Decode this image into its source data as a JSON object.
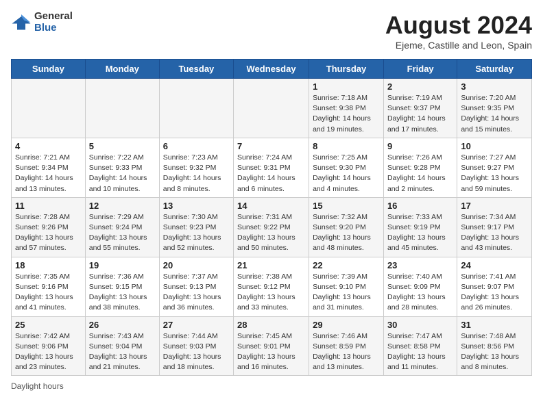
{
  "header": {
    "logo_general": "General",
    "logo_blue": "Blue",
    "month_year": "August 2024",
    "location": "Ejeme, Castille and Leon, Spain"
  },
  "days_of_week": [
    "Sunday",
    "Monday",
    "Tuesday",
    "Wednesday",
    "Thursday",
    "Friday",
    "Saturday"
  ],
  "weeks": [
    [
      {
        "day": "",
        "info": ""
      },
      {
        "day": "",
        "info": ""
      },
      {
        "day": "",
        "info": ""
      },
      {
        "day": "",
        "info": ""
      },
      {
        "day": "1",
        "info": "Sunrise: 7:18 AM\nSunset: 9:38 PM\nDaylight: 14 hours\nand 19 minutes."
      },
      {
        "day": "2",
        "info": "Sunrise: 7:19 AM\nSunset: 9:37 PM\nDaylight: 14 hours\nand 17 minutes."
      },
      {
        "day": "3",
        "info": "Sunrise: 7:20 AM\nSunset: 9:35 PM\nDaylight: 14 hours\nand 15 minutes."
      }
    ],
    [
      {
        "day": "4",
        "info": "Sunrise: 7:21 AM\nSunset: 9:34 PM\nDaylight: 14 hours\nand 13 minutes."
      },
      {
        "day": "5",
        "info": "Sunrise: 7:22 AM\nSunset: 9:33 PM\nDaylight: 14 hours\nand 10 minutes."
      },
      {
        "day": "6",
        "info": "Sunrise: 7:23 AM\nSunset: 9:32 PM\nDaylight: 14 hours\nand 8 minutes."
      },
      {
        "day": "7",
        "info": "Sunrise: 7:24 AM\nSunset: 9:31 PM\nDaylight: 14 hours\nand 6 minutes."
      },
      {
        "day": "8",
        "info": "Sunrise: 7:25 AM\nSunset: 9:30 PM\nDaylight: 14 hours\nand 4 minutes."
      },
      {
        "day": "9",
        "info": "Sunrise: 7:26 AM\nSunset: 9:28 PM\nDaylight: 14 hours\nand 2 minutes."
      },
      {
        "day": "10",
        "info": "Sunrise: 7:27 AM\nSunset: 9:27 PM\nDaylight: 13 hours\nand 59 minutes."
      }
    ],
    [
      {
        "day": "11",
        "info": "Sunrise: 7:28 AM\nSunset: 9:26 PM\nDaylight: 13 hours\nand 57 minutes."
      },
      {
        "day": "12",
        "info": "Sunrise: 7:29 AM\nSunset: 9:24 PM\nDaylight: 13 hours\nand 55 minutes."
      },
      {
        "day": "13",
        "info": "Sunrise: 7:30 AM\nSunset: 9:23 PM\nDaylight: 13 hours\nand 52 minutes."
      },
      {
        "day": "14",
        "info": "Sunrise: 7:31 AM\nSunset: 9:22 PM\nDaylight: 13 hours\nand 50 minutes."
      },
      {
        "day": "15",
        "info": "Sunrise: 7:32 AM\nSunset: 9:20 PM\nDaylight: 13 hours\nand 48 minutes."
      },
      {
        "day": "16",
        "info": "Sunrise: 7:33 AM\nSunset: 9:19 PM\nDaylight: 13 hours\nand 45 minutes."
      },
      {
        "day": "17",
        "info": "Sunrise: 7:34 AM\nSunset: 9:17 PM\nDaylight: 13 hours\nand 43 minutes."
      }
    ],
    [
      {
        "day": "18",
        "info": "Sunrise: 7:35 AM\nSunset: 9:16 PM\nDaylight: 13 hours\nand 41 minutes."
      },
      {
        "day": "19",
        "info": "Sunrise: 7:36 AM\nSunset: 9:15 PM\nDaylight: 13 hours\nand 38 minutes."
      },
      {
        "day": "20",
        "info": "Sunrise: 7:37 AM\nSunset: 9:13 PM\nDaylight: 13 hours\nand 36 minutes."
      },
      {
        "day": "21",
        "info": "Sunrise: 7:38 AM\nSunset: 9:12 PM\nDaylight: 13 hours\nand 33 minutes."
      },
      {
        "day": "22",
        "info": "Sunrise: 7:39 AM\nSunset: 9:10 PM\nDaylight: 13 hours\nand 31 minutes."
      },
      {
        "day": "23",
        "info": "Sunrise: 7:40 AM\nSunset: 9:09 PM\nDaylight: 13 hours\nand 28 minutes."
      },
      {
        "day": "24",
        "info": "Sunrise: 7:41 AM\nSunset: 9:07 PM\nDaylight: 13 hours\nand 26 minutes."
      }
    ],
    [
      {
        "day": "25",
        "info": "Sunrise: 7:42 AM\nSunset: 9:06 PM\nDaylight: 13 hours\nand 23 minutes."
      },
      {
        "day": "26",
        "info": "Sunrise: 7:43 AM\nSunset: 9:04 PM\nDaylight: 13 hours\nand 21 minutes."
      },
      {
        "day": "27",
        "info": "Sunrise: 7:44 AM\nSunset: 9:03 PM\nDaylight: 13 hours\nand 18 minutes."
      },
      {
        "day": "28",
        "info": "Sunrise: 7:45 AM\nSunset: 9:01 PM\nDaylight: 13 hours\nand 16 minutes."
      },
      {
        "day": "29",
        "info": "Sunrise: 7:46 AM\nSunset: 8:59 PM\nDaylight: 13 hours\nand 13 minutes."
      },
      {
        "day": "30",
        "info": "Sunrise: 7:47 AM\nSunset: 8:58 PM\nDaylight: 13 hours\nand 11 minutes."
      },
      {
        "day": "31",
        "info": "Sunrise: 7:48 AM\nSunset: 8:56 PM\nDaylight: 13 hours\nand 8 minutes."
      }
    ]
  ],
  "footer": {
    "daylight_label": "Daylight hours"
  }
}
